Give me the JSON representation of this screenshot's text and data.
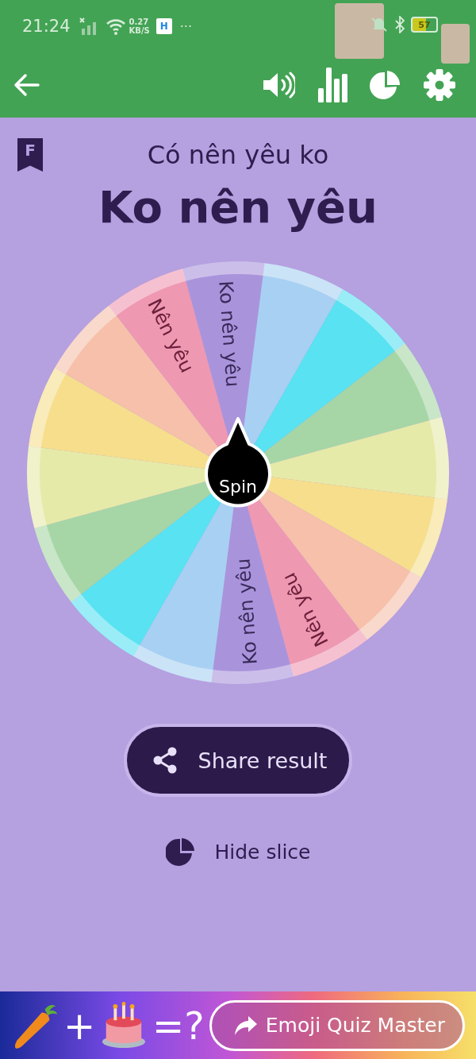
{
  "status_bar": {
    "time": "21:24",
    "speed_value": "0.27",
    "speed_unit": "KB/S",
    "app_badge": "H",
    "more": "···",
    "battery": "57"
  },
  "header_badge": "F",
  "title": "Có nên yêu ko",
  "result": "Ko nên yêu",
  "wheel": {
    "spin_label": "Spin",
    "slices": [
      {
        "color": "#a994dc",
        "label": "Ko nên yêu"
      },
      {
        "color": "#a8d0f2"
      },
      {
        "color": "#58e2f2"
      },
      {
        "color": "#a6d6a6"
      },
      {
        "color": "#e6eaa8"
      },
      {
        "color": "#f6de8c"
      },
      {
        "color": "#f6c0aa"
      },
      {
        "color": "#ef98b2",
        "label": "Nên yêu"
      },
      {
        "color": "#a994dc",
        "label": "Ko nên yêu"
      },
      {
        "color": "#a8d0f2"
      },
      {
        "color": "#58e2f2"
      },
      {
        "color": "#a6d6a6"
      },
      {
        "color": "#e6eaa8"
      },
      {
        "color": "#f6de8c"
      },
      {
        "color": "#f6c0aa"
      },
      {
        "color": "#ef98b2",
        "label": "Nên yêu"
      }
    ]
  },
  "share_button": {
    "label": "Share result"
  },
  "hide_slice": {
    "label": "Hide slice"
  },
  "ad": {
    "plus": "+",
    "equals": "=?",
    "button": "Emoji Quiz Master"
  }
}
